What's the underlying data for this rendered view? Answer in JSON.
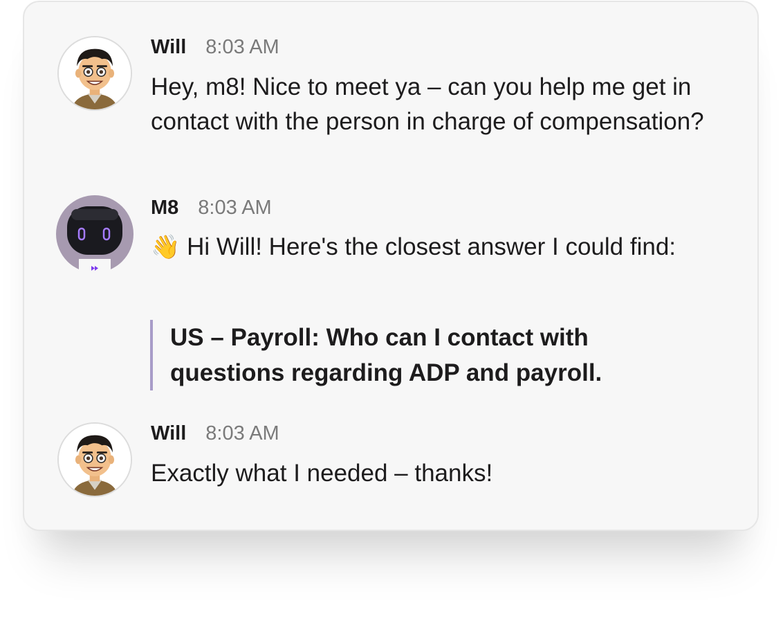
{
  "messages": [
    {
      "author": "Will",
      "time": "8:03 AM",
      "text": "Hey, m8! Nice to meet ya – can you help me get in contact with the person in charge of compensation?",
      "avatar_icon": "memoji-avatar-icon"
    },
    {
      "author": "M8",
      "time": "8:03 AM",
      "emoji": "👋",
      "text": "Hi Will! Here's the closest answer I could find:",
      "quote": "US – Payroll: Who can I contact with questions regarding ADP and payroll.",
      "avatar_icon": "robot-avatar-icon",
      "badge_icon": "fast-forward-icon",
      "accent_color": "#7c3aed"
    },
    {
      "author": "Will",
      "time": "8:03 AM",
      "text": "Exactly what I needed – thanks!",
      "avatar_icon": "memoji-avatar-icon"
    }
  ],
  "colors": {
    "card_background": "#f7f7f7",
    "text": "#1d1c1d",
    "timestamp": "#7a7a7a",
    "quote_bar": "#a89cc8"
  }
}
